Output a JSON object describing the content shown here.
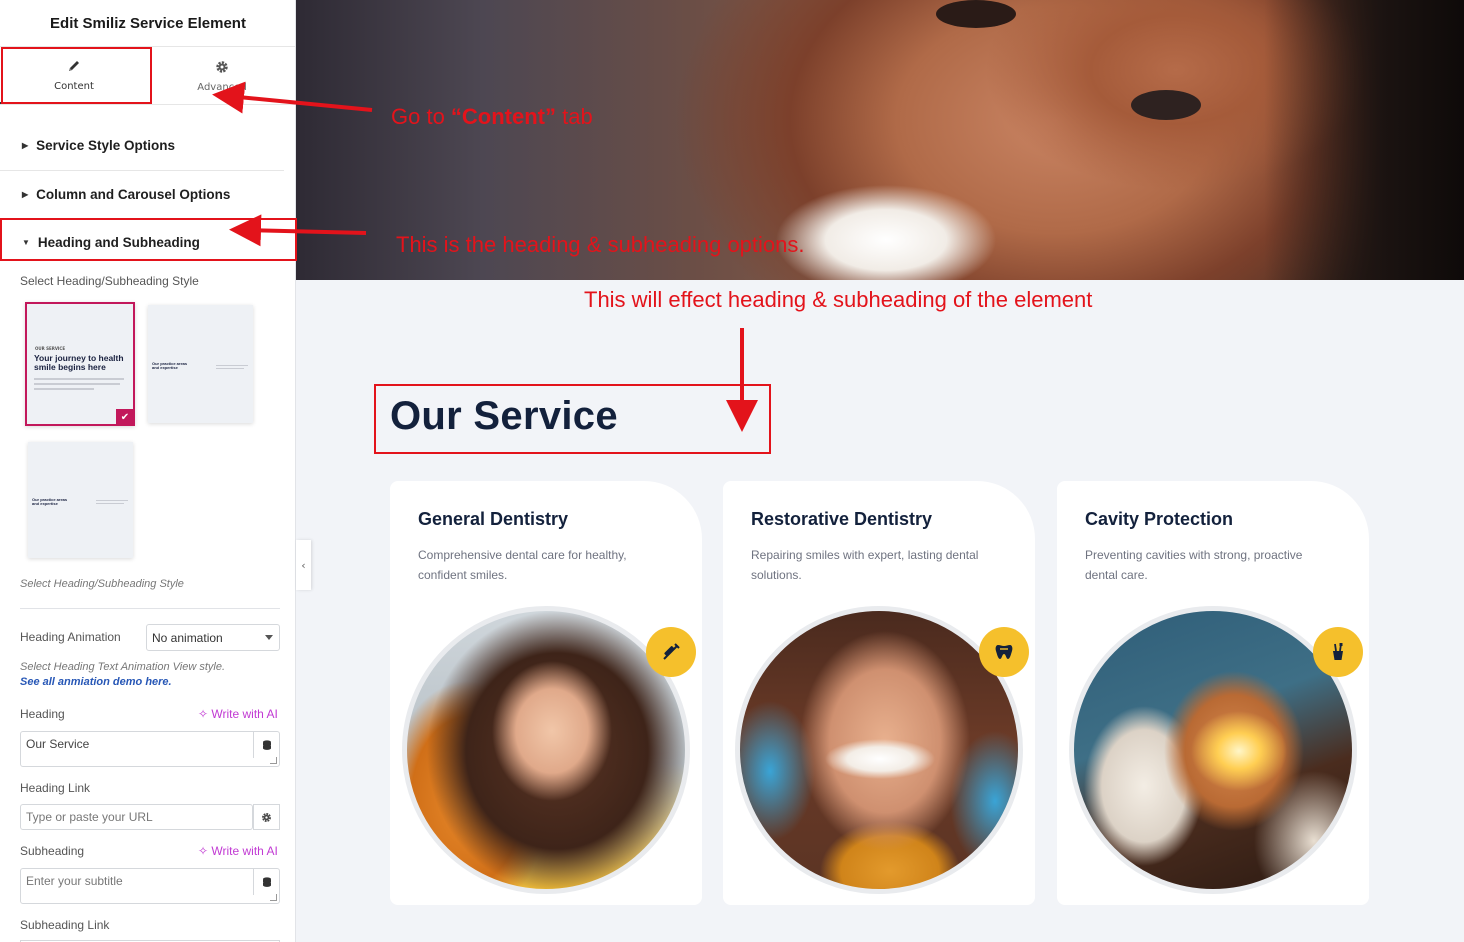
{
  "panel": {
    "title": "Edit Smiliz Service Element",
    "tabs": [
      {
        "label": "Content",
        "icon": "pencil-icon"
      },
      {
        "label": "Advanced",
        "icon": "gear-icon"
      }
    ],
    "sections": [
      {
        "label": "Service Style Options",
        "expanded": false
      },
      {
        "label": "Column and Carousel Options",
        "expanded": false
      },
      {
        "label": "Heading and Subheading",
        "expanded": true
      }
    ],
    "style_label": "Select Heading/Subheading Style",
    "style_hint": "Select Heading/Subheading Style",
    "style_thumbs": [
      {
        "small": "OUR SERVICE",
        "big": "Your journey to health smile begins here",
        "selected": true
      },
      {
        "small": "",
        "big": "Our practice areas and expertise",
        "selected": false
      },
      {
        "small": "",
        "big": "Our practice areas and expertise",
        "selected": false
      }
    ],
    "heading_animation": {
      "label": "Heading Animation",
      "value": "No animation",
      "hint": "Select Heading Text Animation View style.",
      "demo_link": "See all anmiation demo here."
    },
    "heading": {
      "label": "Heading",
      "ai_label": "Write with AI",
      "value": "Our Service"
    },
    "heading_link": {
      "label": "Heading Link",
      "placeholder": "Type or paste your URL"
    },
    "subheading": {
      "label": "Subheading",
      "ai_label": "Write with AI",
      "placeholder": "Enter your subtitle"
    },
    "subheading_link": {
      "label": "Subheading Link"
    }
  },
  "preview": {
    "section_title": "Our Service",
    "cards": [
      {
        "title": "General Dentistry",
        "desc": "Comprehensive dental care for healthy, confident smiles.",
        "icon": "syringe-icon"
      },
      {
        "title": "Restorative Dentistry",
        "desc": "Repairing smiles with expert, lasting dental solutions.",
        "icon": "tooth-icon"
      },
      {
        "title": "Cavity Protection",
        "desc": "Preventing cavities with strong, proactive dental care.",
        "icon": "toothbrush-cup-icon"
      }
    ]
  },
  "annotations": {
    "content_tab_prefix": "Go  to ",
    "content_tab_bold": "“Content”",
    "content_tab_suffix": " tab",
    "heading_options": "This is the heading & subheading options.",
    "effect": "This will effect heading & subheading of the element",
    "color": "#e3131b"
  }
}
